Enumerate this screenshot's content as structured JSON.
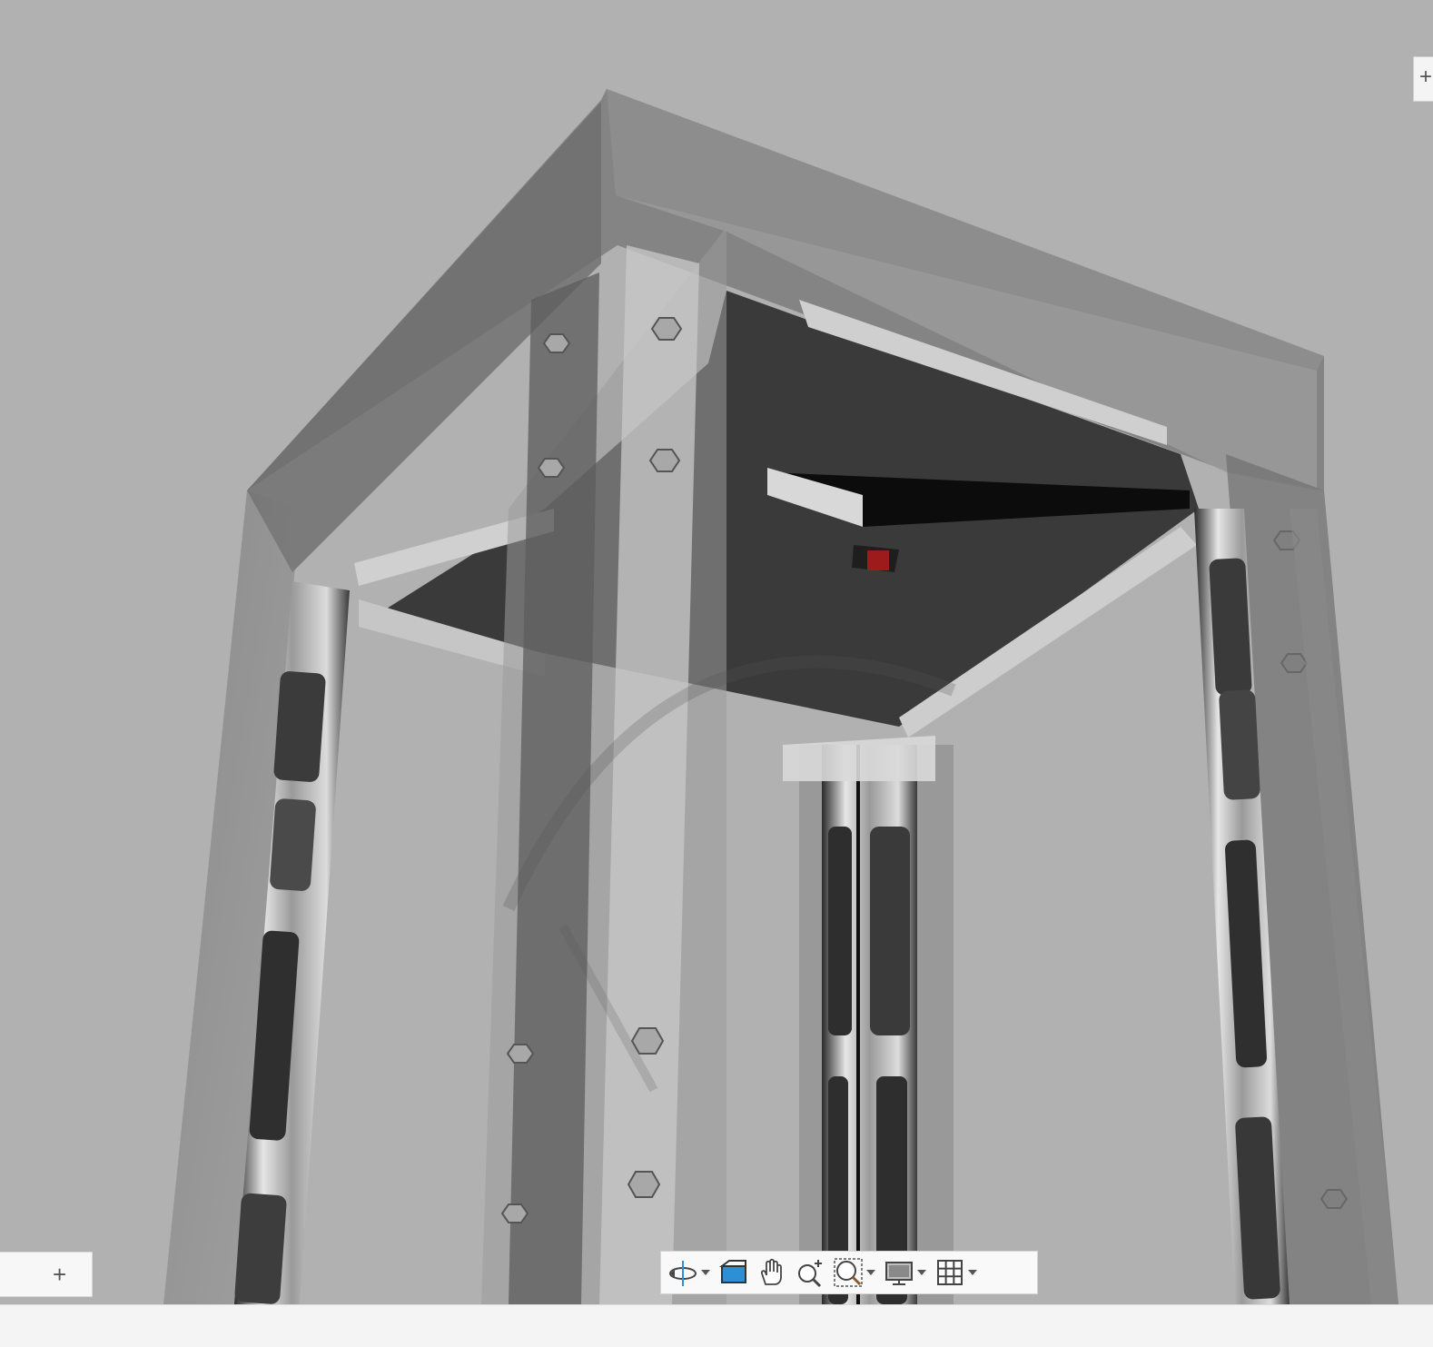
{
  "viewport": {
    "background_color": "#b1b1b1",
    "model_description_icon": "3d-model-frame"
  },
  "browser_panel": {
    "add_icon": "plus-icon"
  },
  "corner_tab": {
    "icon": "plus-icon"
  },
  "nav_toolbar": {
    "tools": [
      {
        "name": "orbit",
        "icon": "orbit-icon",
        "has_dropdown": true
      },
      {
        "name": "look-at",
        "icon": "look-at-icon",
        "has_dropdown": false
      },
      {
        "name": "pan",
        "icon": "pan-hand-icon",
        "has_dropdown": false
      },
      {
        "name": "zoom",
        "icon": "zoom-icon",
        "has_dropdown": false
      },
      {
        "name": "fit",
        "icon": "zoom-window-icon",
        "has_dropdown": true
      },
      {
        "name": "display-settings",
        "icon": "display-settings-icon",
        "has_dropdown": true
      },
      {
        "name": "grid-settings",
        "icon": "grid-icon",
        "has_dropdown": true
      }
    ]
  },
  "colors": {
    "toolbar_bg": "#f9f9f9",
    "accent_blue": "#2d8fd6",
    "status_bar": "#f4f4f4"
  }
}
